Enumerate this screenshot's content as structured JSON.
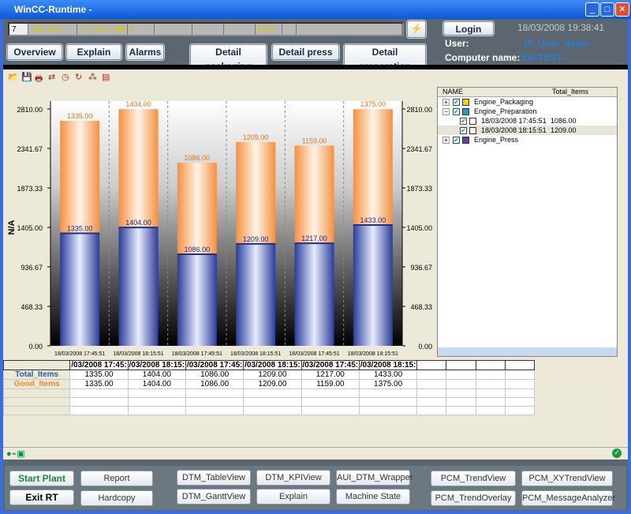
{
  "window": {
    "title": "WinCC-Runtime -",
    "min": "_",
    "max": "□",
    "close": "✕"
  },
  "alarm_line": {
    "number": "7",
    "date": "18/03/08",
    "time": "07:38:41 PM",
    "count": "9",
    "status": "Error"
  },
  "nav": {
    "overview": "Overview",
    "explain": "Explain",
    "alarms": "Alarms",
    "detail_packaging": "Detail packaging",
    "detail_press": "Detail press",
    "detail_preparation": "Detail preparation"
  },
  "header": {
    "login": "Login",
    "datetime": "18/03/2008 19:38:41",
    "user_label": "User:",
    "user": "PI_User_demo",
    "computer_label": "Computer name:",
    "computer": "VM-TEST"
  },
  "toolbar": {
    "icons": [
      "open-icon",
      "save-icon",
      "print-icon",
      "export-icon",
      "clock-icon",
      "refresh-icon",
      "magic-wand-icon",
      "properties-icon"
    ]
  },
  "chart_data": {
    "type": "bar",
    "stacked": true,
    "ylabel": "N/A",
    "ylim": [
      0,
      2810
    ],
    "yticks": [
      "0.00",
      "468.33",
      "936.67",
      "1405.00",
      "1873.33",
      "2341.67",
      "2810.00"
    ],
    "categories": [
      "18/03/2008 17:45:51",
      "18/03/2008 18:15:51",
      "18/03/2008 17:45:51",
      "18/03/2008 18:15:51",
      "18/03/2008 17:45:51",
      "18/03/2008 18:15:51"
    ],
    "groups": [
      "Engine_Packaging",
      "Engine_Preparation",
      "Engine_Press"
    ],
    "series": [
      {
        "name": "Total_Items",
        "color": "#3a55b0",
        "values": [
          1335,
          1404,
          1086,
          1209,
          1217,
          1433
        ]
      },
      {
        "name": "Good_Items",
        "color": "#f5a050",
        "values": [
          1335,
          1404,
          1086,
          1209,
          1159,
          1375
        ]
      }
    ]
  },
  "tree": {
    "col_name": "NAME",
    "col_total": "Total_Items",
    "items": [
      {
        "label": "Engine_Packaging",
        "expander": "+",
        "color": "#e8d800",
        "level": 0
      },
      {
        "label": "Engine_Preparation",
        "expander": "−",
        "color": "#1aa0c0",
        "level": 0
      },
      {
        "label": "18/03/2008 17:45:51",
        "value": "1086.00",
        "level": 1
      },
      {
        "label": "18/03/2008 18:15:51",
        "value": "1209.00",
        "level": 1,
        "selected": true
      },
      {
        "label": "Engine_Press",
        "expander": "+",
        "color": "#6040a0",
        "level": 0
      }
    ]
  },
  "table": {
    "headers": [
      "/03/2008 17:45:",
      "/03/2008 18:15:",
      "/03/2008 17:45:",
      "/03/2008 18:15:",
      "/03/2008 17:45:",
      "/03/2008 18:15:"
    ],
    "rows": [
      {
        "name": "Total_Items",
        "color": "#2b5aa8",
        "values": [
          "1335.00",
          "1404.00",
          "1086.00",
          "1209.00",
          "1217.00",
          "1433.00"
        ]
      },
      {
        "name": "Good_Items",
        "color": "#f08c30",
        "values": [
          "1335.00",
          "1404.00",
          "1086.00",
          "1209.00",
          "1159.00",
          "1375.00"
        ]
      }
    ]
  },
  "bottom": {
    "start_plant": "Start Plant",
    "exit_rt": "Exit RT",
    "report": "Report",
    "hardcopy": "Hardcopy",
    "dtm_table": "DTM_TableView",
    "dtm_kpi": "DTM_KPIView",
    "aui": "AUI_DTM_Wrapper",
    "dtm_gantt": "DTM_GanttView",
    "explain": "Explain",
    "machine_state": "Machine State",
    "pcm_trend": "PCM_TrendView",
    "pcm_xy": "PCM_XYTrendView",
    "pcm_overlay": "PCM_TrendOverlay",
    "pcm_msg": "PCM_MessageAnalyzer"
  }
}
